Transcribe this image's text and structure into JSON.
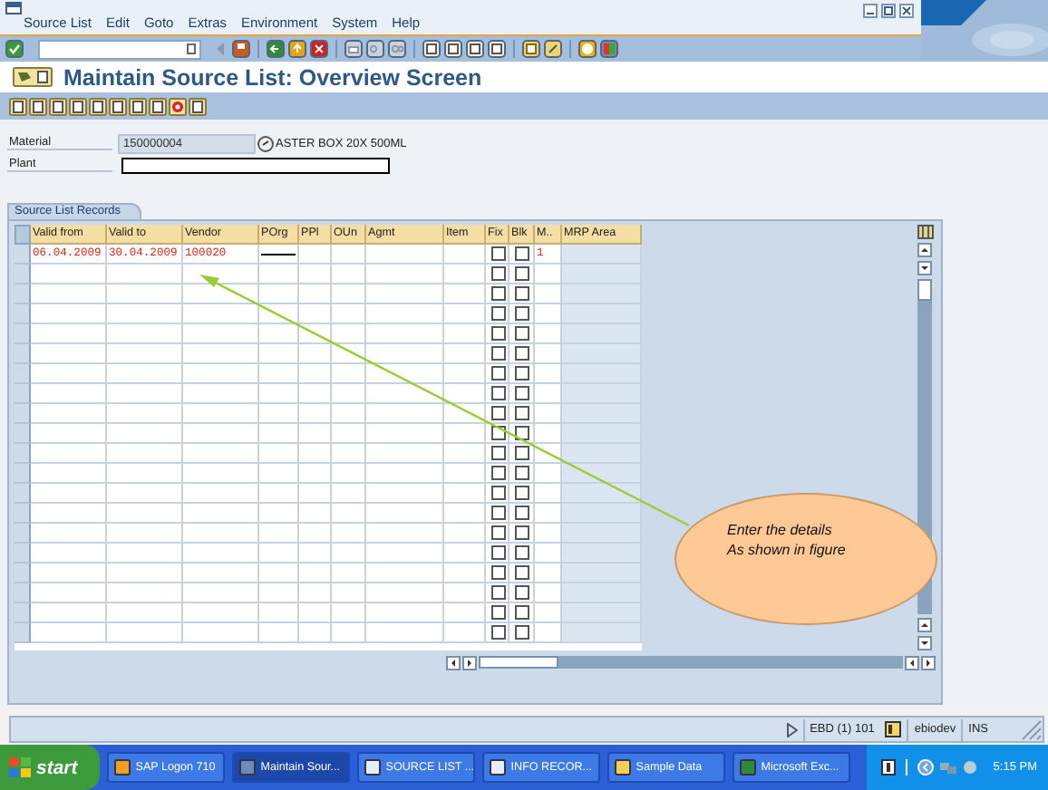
{
  "menu": [
    "Source List",
    "Edit",
    "Goto",
    "Extras",
    "Environment",
    "System",
    "Help"
  ],
  "title": "Maintain Source List: Overview Screen",
  "header_fields": [
    {
      "label": "Material",
      "kind": "display",
      "value": "150000004",
      "description": "ASTER BOX 20X 500ML"
    },
    {
      "label": "Plant",
      "kind": "input"
    }
  ],
  "source_list": {
    "title": "Source List Records",
    "columns": [
      "Valid from",
      "Valid to",
      "Vendor",
      "POrg",
      "PPl",
      "OUn",
      "Agmt",
      "Item",
      "Fix",
      "Blk",
      "M..",
      "MRP Area"
    ],
    "rows": [
      {
        "valid_from": "06.04.2009",
        "valid_to": "30.04.2009",
        "vendor": "100020",
        "m": "1",
        "porg_outlined": true,
        "fix": false,
        "blk": false
      },
      {
        "porg_outlined": false,
        "fix": false,
        "blk": false
      },
      {
        "porg_outlined": false,
        "fix": false,
        "blk": false
      },
      {
        "porg_outlined": false,
        "fix": false,
        "blk": false
      },
      {
        "porg_outlined": false,
        "fix": false,
        "blk": false
      },
      {
        "porg_outlined": false,
        "fix": false,
        "blk": false
      },
      {
        "porg_outlined": false,
        "fix": false,
        "blk": false
      },
      {
        "porg_outlined": false,
        "fix": false,
        "blk": false
      },
      {
        "porg_outlined": false,
        "fix": false,
        "blk": false
      },
      {
        "porg_outlined": false,
        "fix": false,
        "blk": false
      },
      {
        "porg_outlined": false,
        "fix": false,
        "blk": false
      },
      {
        "porg_outlined": false,
        "fix": false,
        "blk": false
      },
      {
        "porg_outlined": false,
        "fix": false,
        "blk": false
      },
      {
        "porg_outlined": false,
        "fix": false,
        "blk": false
      },
      {
        "porg_outlined": false,
        "fix": false,
        "blk": false
      },
      {
        "porg_outlined": false,
        "fix": false,
        "blk": false
      },
      {
        "porg_outlined": false,
        "fix": false,
        "blk": false
      },
      {
        "porg_outlined": false,
        "fix": false,
        "blk": false
      },
      {
        "porg_outlined": false,
        "fix": false,
        "blk": false
      },
      {
        "porg_outlined": false,
        "fix": false,
        "blk": false
      }
    ]
  },
  "callout": {
    "text": "Enter the details\nAs shown in figure"
  },
  "status_bar": {
    "system": "EBD (1) 101",
    "server": "ebiodev",
    "mode": "INS"
  },
  "taskbar": {
    "start": "start",
    "tasks": [
      {
        "label": "SAP Logon 710",
        "selected": false
      },
      {
        "label": "Maintain Sour...",
        "selected": true
      },
      {
        "label": "SOURCE LIST ...",
        "selected": false
      },
      {
        "label": "INFO RECOR...",
        "selected": false
      },
      {
        "label": "Sample Data",
        "selected": false
      },
      {
        "label": "Microsoft Exc...",
        "selected": false
      }
    ],
    "clock": "5:15 PM"
  }
}
